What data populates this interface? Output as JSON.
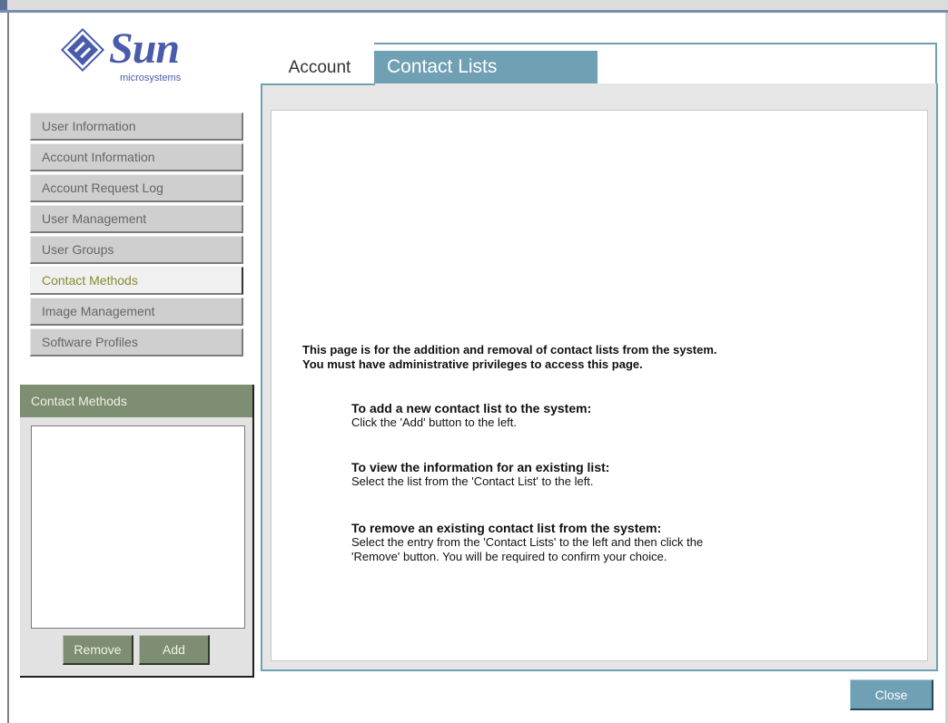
{
  "logo": {
    "brand": "Sun",
    "sub": "microsystems"
  },
  "nav": {
    "items": [
      {
        "label": "User Information"
      },
      {
        "label": "Account Information"
      },
      {
        "label": "Account Request Log"
      },
      {
        "label": "User Management"
      },
      {
        "label": "User Groups"
      },
      {
        "label": "Contact Methods"
      },
      {
        "label": "Image Management"
      },
      {
        "label": "Software Profiles"
      }
    ],
    "active": "Contact Methods"
  },
  "contact_panel": {
    "title": "Contact Methods",
    "remove_label": "Remove",
    "add_label": "Add"
  },
  "tabs": {
    "account": "Account",
    "contact_lists": "Contact Lists"
  },
  "content": {
    "intro_line1": "This page is for the addition and removal of contact lists from the system.",
    "intro_line2": "You must have administrative privileges to access this page.",
    "sections": [
      {
        "heading": "To add a new contact list to the system:",
        "text1": "Click the 'Add' button to the left.",
        "text2": ""
      },
      {
        "heading": "To view the information for an existing list:",
        "text1": "Select the list from the 'Contact List' to the left.",
        "text2": ""
      },
      {
        "heading": "To remove an existing contact list from the system:",
        "text1": "Select the entry from the 'Contact Lists' to the left and then click the",
        "text2": "'Remove' button. You will be required to confirm your choice."
      }
    ]
  },
  "footer": {
    "close_label": "Close"
  },
  "colors": {
    "accent": "#6fa0b4",
    "panel_green": "#7d8e73",
    "brand_blue": "#4a5bab"
  }
}
